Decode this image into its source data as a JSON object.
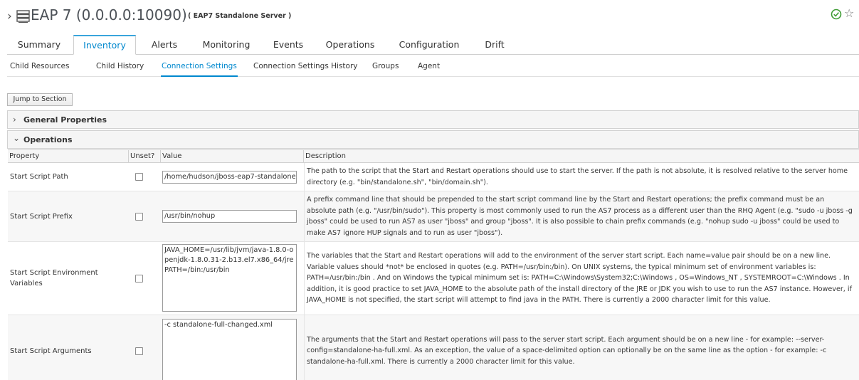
{
  "header": {
    "title": "EAP 7 (0.0.0.0:10090)",
    "subtitle": "( EAP7 Standalone Server )"
  },
  "tabs": [
    {
      "label": "Summary"
    },
    {
      "label": "Inventory",
      "active": true
    },
    {
      "label": "Alerts"
    },
    {
      "label": "Monitoring"
    },
    {
      "label": "Events"
    },
    {
      "label": "Operations"
    },
    {
      "label": "Configuration"
    },
    {
      "label": "Drift"
    }
  ],
  "subtabs": [
    {
      "label": "Child Resources"
    },
    {
      "label": "Child History"
    },
    {
      "label": "Connection Settings",
      "active": true
    },
    {
      "label": "Connection Settings History"
    },
    {
      "label": "Groups"
    },
    {
      "label": "Agent"
    }
  ],
  "jump_button": "Jump to Section",
  "sections": {
    "general": "General Properties",
    "operations": "Operations"
  },
  "table": {
    "headers": [
      "Property",
      "Unset?",
      "Value",
      "Description"
    ],
    "rows": [
      {
        "property": "Start Script Path",
        "unset": false,
        "value": "/home/hudson/jboss-eap7-standalone",
        "description": "The path to the script that the Start and Restart operations should use to start the server. If the path is not absolute, it is resolved relative to the server home directory (e.g. \"bin/standalone.sh\", \"bin/domain.sh\")."
      },
      {
        "property": "Start Script Prefix",
        "unset": false,
        "value": "/usr/bin/nohup",
        "description": "A prefix command line that should be prepended to the start script command line by the Start and Restart operations; the prefix command must be an absolute path (e.g. \"/usr/bin/sudo\"). This property is most commonly used to run the AS7 process as a different user than the RHQ Agent (e.g. \"sudo -u jboss -g jboss\" could be used to run AS7 as user \"jboss\" and group \"jboss\". It is also possible to chain prefix commands (e.g. \"nohup sudo -u jboss\" could be used to make AS7 ignore HUP signals and to run as user \"jboss\")."
      },
      {
        "property": "Start Script Environment Variables",
        "unset": false,
        "value": "JAVA_HOME=/usr/lib/jvm/java-1.8.0-openjdk-1.8.0.31-2.b13.el7.x86_64/jre\nPATH=/bin:/usr/bin",
        "description": "The variables that the Start and Restart operations will add to the environment of the server start script. Each name=value pair should be on a new line. Variable values should *not* be enclosed in quotes (e.g. PATH=/usr/bin:/bin). On UNIX systems, the typical minimum set of environment variables is: PATH=/usr/bin:/bin . And on Windows the typical minimum set is: PATH=C:\\Windows\\System32;C:\\Windows , OS=Windows_NT , SYSTEMROOT=C:\\Windows . In addition, it is good practice to set JAVA_HOME to the absolute path of the install directory of the JRE or JDK you wish to use to run the AS7 instance. However, if JAVA_HOME is not specified, the start script will attempt to find java in the PATH. There is currently a 2000 character limit for this value."
      },
      {
        "property": "Start Script Arguments",
        "unset": false,
        "value": "-c standalone-full-changed.xml",
        "description": "The arguments that the Start and Restart operations will pass to the server start script. Each argument should be on a new line - for example: --server-config=standalone-ha-full.xml. As an exception, the value of a space-delimited option can optionally be on the same line as the option - for example: -c standalone-ha-full.xml. There is currently a 2000 character limit for this value."
      }
    ]
  },
  "colors": {
    "accent": "#0088ce",
    "tab_border": "#39a5dc",
    "ok_green": "#3f9c35"
  },
  "icons": {
    "breadcrumb": "chevron-right-icon",
    "server": "server-icon",
    "availability": "check-circle-icon",
    "favorite": "star-outline-icon"
  }
}
